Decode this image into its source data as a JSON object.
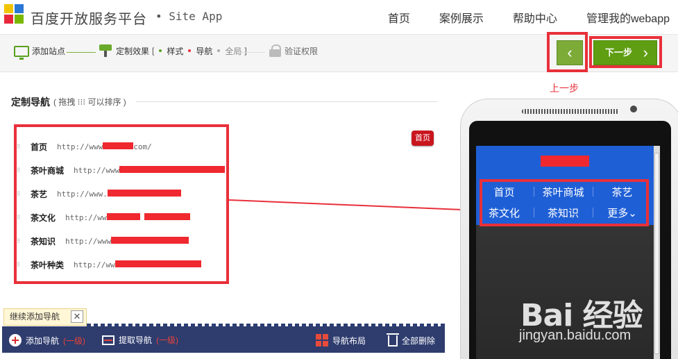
{
  "header": {
    "brand": "百度开放服务平台",
    "brand_sub": "• Site App",
    "nav": [
      "首页",
      "案例展示",
      "帮助中心",
      "管理我的webapp"
    ]
  },
  "steps": {
    "add_site": "添加站点",
    "customize": "定制效果",
    "customize_style": "样式",
    "customize_nav": "导航",
    "customize_global": "全局",
    "verify": "验证权限"
  },
  "buttons": {
    "prev_chevron": "‹",
    "next_label": "下一步",
    "next_chevron": "›",
    "prev_annotation": "上一步"
  },
  "section": {
    "title": "定制导航",
    "hint": "( 拖拽 ⁝⁝⁝ 可以排序 )"
  },
  "nav_items": [
    {
      "name": "首页",
      "url_prefix": "http://www",
      "url_suffix": "com/"
    },
    {
      "name": "茶叶商城",
      "url_prefix": "http://www",
      "url_suffix": ""
    },
    {
      "name": "茶艺",
      "url_prefix": "http://www.",
      "url_suffix": ""
    },
    {
      "name": "茶文化",
      "url_prefix": "http://ww",
      "url_suffix": ""
    },
    {
      "name": "茶知识",
      "url_prefix": "http://www",
      "url_suffix": ""
    },
    {
      "name": "茶叶种类",
      "url_prefix": "http://ww",
      "url_suffix": ""
    }
  ],
  "home_badge": "首页",
  "add_tip": {
    "label": "继续添加导航",
    "close": "✕"
  },
  "bottom_bar": {
    "add": "添加导航",
    "add_level": "(一级)",
    "extract": "提取导航",
    "extract_level": "(一级)",
    "layout": "导航布局",
    "delete_all": "全部删除"
  },
  "phone_nav": [
    "首页",
    "茶叶商城",
    "茶艺",
    "茶文化",
    "茶知识",
    "更多⌄"
  ],
  "watermark": {
    "main": "Bai 经验",
    "sub": "jingyan.baidu.com"
  },
  "colors": {
    "accent_green": "#5f9e12",
    "annotation_red": "#e8303a",
    "app_blue": "#1f5fd6",
    "bottom_bar": "#2e3c6e"
  }
}
